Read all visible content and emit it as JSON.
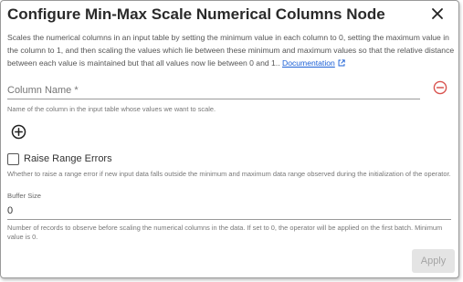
{
  "dialog": {
    "title": "Configure Min-Max Scale Numerical Columns Node",
    "close_icon": "close-icon",
    "description": "Scales the numerical columns in an input table by setting the minimum value in each column to 0, setting the maximum value in the column to 1, and then scaling the values which lie between these minimum and maximum values so that the relative distance between each value is maintained but that all values now lie between 0 and 1.. ",
    "documentation_link": "Documentation",
    "documentation_icon": "external-link-icon"
  },
  "fields": {
    "column_name": {
      "placeholder": "Column Name *",
      "value": "",
      "help": "Name of the column in the input table whose values we want to scale.",
      "remove_icon": "remove-circle-icon"
    },
    "add_icon": "add-circle-icon",
    "raise_range_errors": {
      "label": "Raise Range Errors",
      "checked": false,
      "help": "Whether to raise a range error if new input data falls outside the minimum and maximum data range observed during the initialization of the operator."
    },
    "buffer_size": {
      "label": "Buffer Size",
      "value": "0",
      "help": "Number of records to observe before scaling the numerical columns in the data. If set to 0, the operator will be applied on the first batch. Minimum value is 0."
    }
  },
  "footer": {
    "apply_label": "Apply"
  },
  "colors": {
    "link": "#1a5fd6",
    "remove": "#d9534f",
    "disabled_bg": "#e4e4e4",
    "disabled_text": "#a5a5a5"
  }
}
